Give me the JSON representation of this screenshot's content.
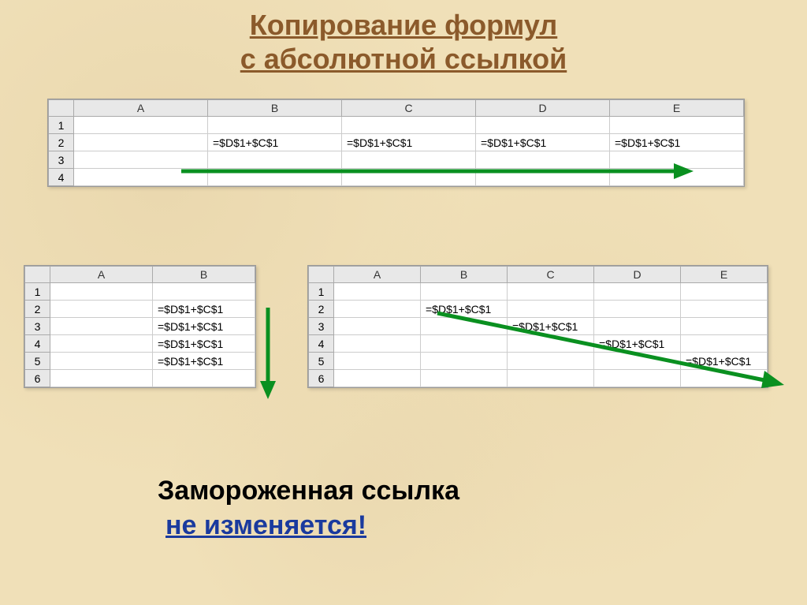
{
  "title_line1": "Копирование формул",
  "title_line2": "с абсолютной ссылкой",
  "formula": "=$D$1+$C$1",
  "cols5": [
    "A",
    "B",
    "C",
    "D",
    "E"
  ],
  "cols2": [
    "A",
    "B"
  ],
  "table1": {
    "rows": [
      "1",
      "2",
      "3",
      "4"
    ],
    "data": {
      "B2": "=$D$1+$C$1",
      "C2": "=$D$1+$C$1",
      "D2": "=$D$1+$C$1",
      "E2": "=$D$1+$C$1"
    }
  },
  "table2": {
    "rows": [
      "1",
      "2",
      "3",
      "4",
      "5",
      "6"
    ],
    "data": {
      "B2": "=$D$1+$C$1",
      "B3": "=$D$1+$C$1",
      "B4": "=$D$1+$C$1",
      "B5": "=$D$1+$C$1"
    }
  },
  "table3": {
    "rows": [
      "1",
      "2",
      "3",
      "4",
      "5",
      "6"
    ],
    "data": {
      "B2": "=$D$1+$C$1",
      "C3": "=$D$1+$C$1",
      "D4": "=$D$1+$C$1",
      "E5": "=$D$1+$C$1"
    }
  },
  "bottom_line1": "Замороженная ссылка",
  "bottom_line2": "не изменяется!"
}
